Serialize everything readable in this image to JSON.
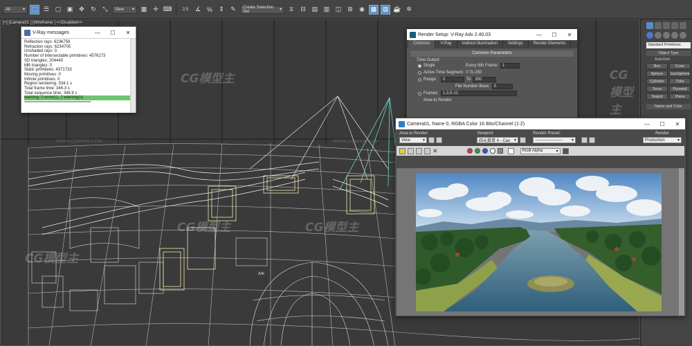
{
  "toolbar": {
    "selection_filter": "All",
    "reference_coord": "View",
    "snap_angle": "2.5",
    "snap_label": "%",
    "named_selection": "Create Selection Set"
  },
  "viewport": {
    "label": "[+] [Camera01 ] [Wireframe ] <<Disabled>>",
    "watermark": "CG模型主",
    "watermark_url": "WWW.CGMXW.COM",
    "scene_text": "Ark"
  },
  "command_panel": {
    "category_dropdown": "Standard Primitives",
    "object_type_title": "Object Type",
    "autogrid_label": "AutoGrid",
    "buttons": [
      "Box",
      "Cone",
      "Sphere",
      "GeoSphere",
      "Cylinder",
      "Tube",
      "Torus",
      "Pyramid",
      "Teapot",
      "Plane"
    ],
    "name_color_title": "Name and Color"
  },
  "vray_messages": {
    "title": "V-Ray messages",
    "lines": [
      "Reflection rays: 6236759",
      "Refraction rays: 6234705",
      "Unshaded rays: 0",
      "Number of intersectable primitives: 4576173",
      "SD triangles: 204440",
      "MB triangles: 0",
      "Static primitives: 4371733",
      "Moving primitives: 0",
      "Infinite primitives: 0",
      "Region rendering: 334.1 s",
      "Total frame time: 346.3 s",
      "Total sequence time: 346.9 s"
    ],
    "warning": "warning: 0 error(s), 2 warning(s)",
    "separator": "================================"
  },
  "render_setup": {
    "title": "Render Setup: V-Ray Adv 2.40.03",
    "tabs": [
      "Common",
      "V-Ray",
      "Indirect illumination",
      "Settings",
      "Render Elements"
    ],
    "rollout_title": "Common Parameters",
    "group_label": "Time Output",
    "single_label": "Single",
    "every_nth_label": "Every Nth Frame:",
    "every_nth_value": "1",
    "active_segment_label": "Active Time Segment:",
    "active_segment_value": "0 To 250",
    "range_label": "Range:",
    "range_from": "0",
    "range_to_label": "To",
    "range_to": "300",
    "file_number_label": "File Number Base:",
    "file_number_value": "0",
    "frames_label": "Frames",
    "frames_value": "1,3,5-12",
    "area_label": "Area to Render"
  },
  "framebuffer": {
    "title": "Camera01, frame 0, RGBA Color 16 Bits/Channel (1:2)",
    "area_label": "Area to Render:",
    "area_value": "View",
    "viewport_label": "Viewport:",
    "viewport_value": "四元菜单 4 - Can",
    "preset_label": "Render Preset:",
    "preset_value": "--------------------",
    "render_label": "Render",
    "render_value": "Production",
    "channel_value": "RGB Alpha"
  },
  "colors": {
    "accent": "#5a8cc8",
    "wire_white": "#e8e8e8",
    "wire_cyan": "#6fd6c8",
    "wire_yellow": "#f2eab0",
    "sky": "#9ec3e8",
    "water": "#3a6d8a",
    "forest": "#2f5a2a",
    "warning_bar": "#6ec46e"
  }
}
